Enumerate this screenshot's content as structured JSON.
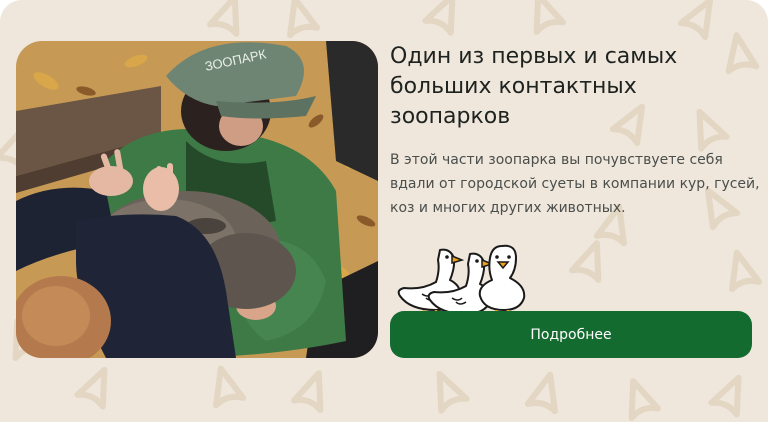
{
  "card": {
    "title": "Один из первых и самых больших контактных зоопарков",
    "description": "В этой части зоопарка вы почувствуете себя вдали от городской суеты в компании кур, гусей, коз и многих других животных.",
    "button_label": "Подробнее",
    "photo_cap_text": "ЗООПАРК",
    "illustration_icon": "geese-illustration"
  },
  "colors": {
    "background": "#efe6dc",
    "accent": "#146b30",
    "title": "#1e2320",
    "text": "#4a4f4c"
  }
}
